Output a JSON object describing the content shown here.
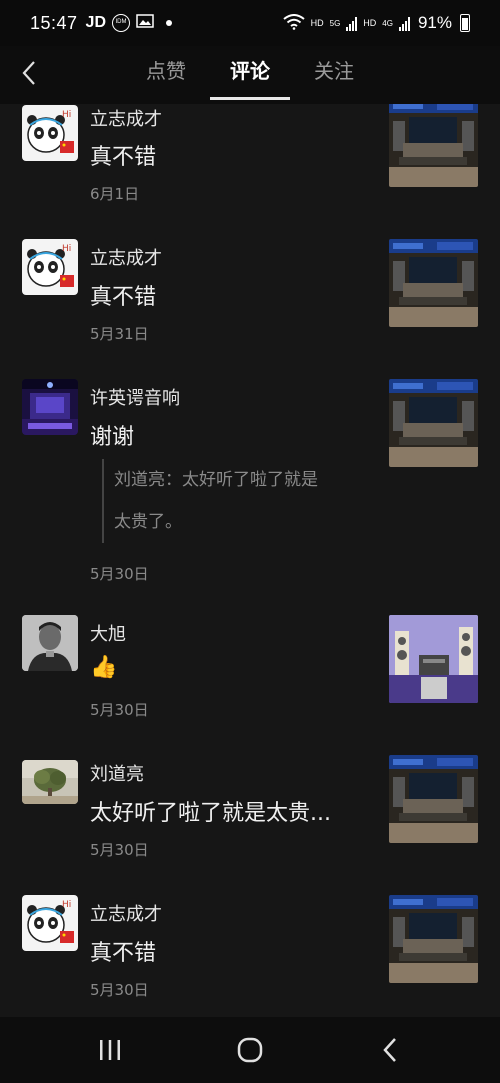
{
  "status_bar": {
    "time": "15:47",
    "carrier": "JD",
    "idm_label": "IDM",
    "hd1": "HD",
    "net1": "5G",
    "hd2": "HD",
    "net2": "4G",
    "battery": "91%"
  },
  "header": {
    "tabs": [
      {
        "label": "点赞",
        "active": false
      },
      {
        "label": "评论",
        "active": true
      },
      {
        "label": "关注",
        "active": false
      }
    ]
  },
  "comments": [
    {
      "user": "立志成才",
      "text": "真不错",
      "date": "6月1日",
      "avatar": "panda",
      "thumb": "av-room"
    },
    {
      "user": "立志成才",
      "text": "真不错",
      "date": "5月31日",
      "avatar": "panda",
      "thumb": "av-room"
    },
    {
      "user": "许英谔音响",
      "text": "谢谢",
      "quote_line1": "刘道亮：太好听了啦了就是",
      "quote_line2": "太贵了。",
      "date": "5月30日",
      "avatar": "stage",
      "thumb": "av-room"
    },
    {
      "user": "大旭",
      "text": "👍",
      "date": "5月30日",
      "avatar": "portrait",
      "thumb": "speakers"
    },
    {
      "user": "刘道亮",
      "text": "太好听了啦了就是太贵...",
      "date": "5月30日",
      "avatar": "tree",
      "thumb": "av-room"
    },
    {
      "user": "立志成才",
      "text": "真不错",
      "date": "5月30日",
      "avatar": "panda",
      "thumb": "av-room"
    }
  ],
  "colors": {
    "background": "#161616",
    "accent": "#ffffff",
    "muted": "#8a8a8a"
  }
}
